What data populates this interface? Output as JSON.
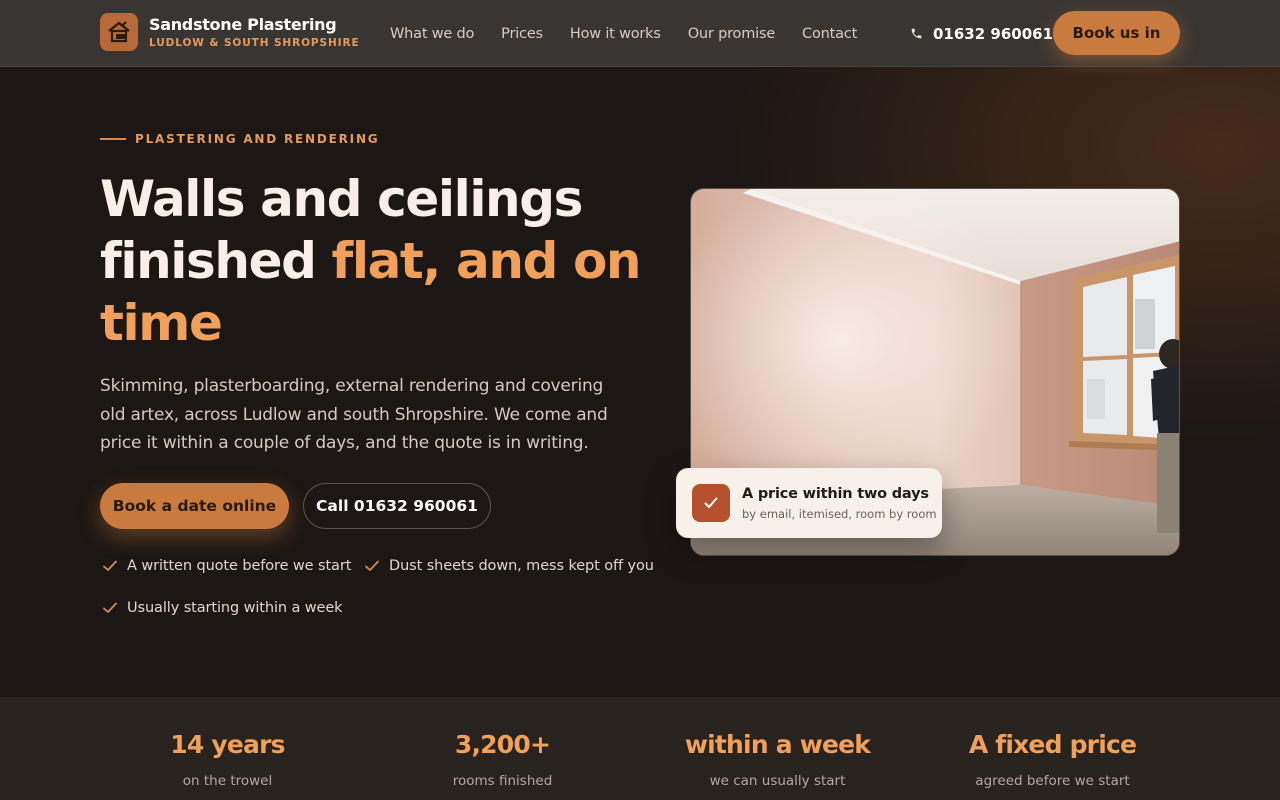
{
  "brand": {
    "name": "Sandstone Plastering",
    "tagline": "LUDLOW & SOUTH SHROPSHIRE",
    "logo_icon": "house-trowel-icon"
  },
  "nav": {
    "links": [
      "What we do",
      "Prices",
      "How it works",
      "Our promise",
      "Contact"
    ],
    "phone": "01632 960061",
    "phone_icon": "phone-icon",
    "cta": "Book us in"
  },
  "hero": {
    "eyebrow": "PLASTERING AND RENDERING",
    "headline_line1": "Walls and ceilings",
    "headline_line2_plain": "finished ",
    "headline_line2_accent": "flat, and on",
    "headline_line3_accent": "time",
    "lede": "Skimming, plasterboarding, external rendering and covering old artex, across Ludlow and south Shropshire. We come and price it within a couple of days, and the quote is in writing.",
    "primary_button": "Book a date online",
    "secondary_button": "Call 01632 960061",
    "checks": [
      "A written quote before we start",
      "Dust sheets down, mess kept off you",
      "Usually starting within a week"
    ]
  },
  "badge": {
    "title": "A price within two days",
    "subtitle": "by email, itemised, room by room",
    "icon": "checkmark-icon"
  },
  "stats": [
    {
      "value": "14 years",
      "label": "on the trowel"
    },
    {
      "value": "3,200+",
      "label": "rooms finished"
    },
    {
      "value": "within a week",
      "label": "we can usually start"
    },
    {
      "value": "A fixed price",
      "label": "agreed before we start"
    }
  ],
  "colors": {
    "accent": "#f0a05a",
    "button": "#c97a3f",
    "background": "#1c1714",
    "nav": "#393532",
    "badge_icon": "#b6502f"
  }
}
